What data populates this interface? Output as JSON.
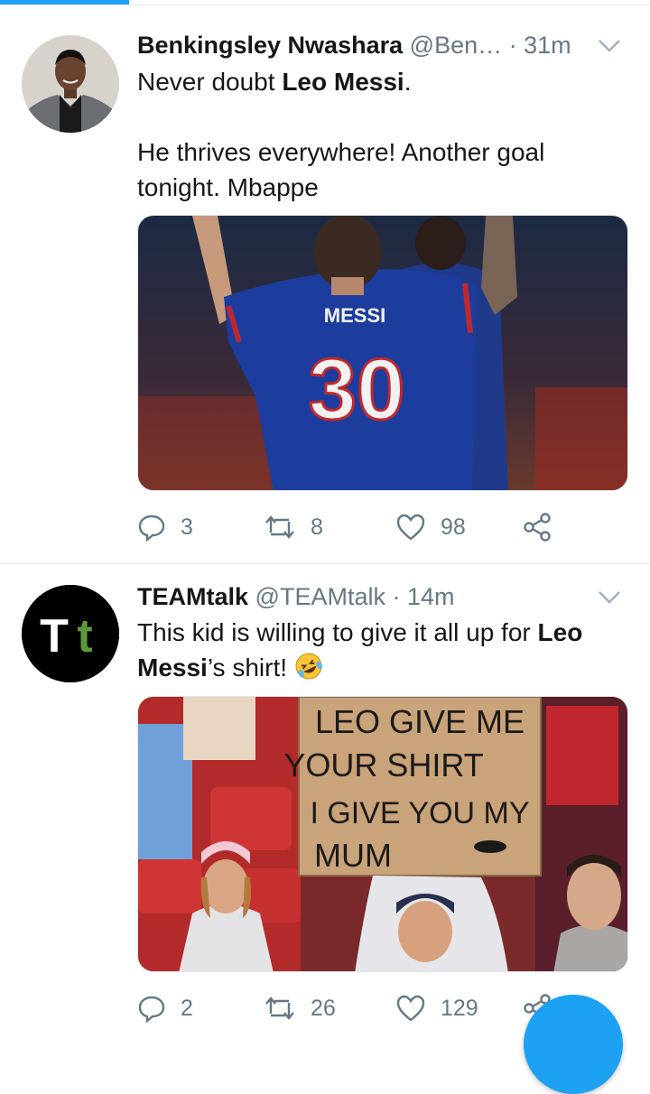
{
  "colors": {
    "accent": "#1da1f2",
    "text": "#14171a",
    "muted": "#657786",
    "divider": "#e1e8ed"
  },
  "tweets": [
    {
      "author_name": "Benkingsley Nwashara",
      "handle": "@Ben…",
      "separator": "·",
      "time": "31m",
      "text_line1_before": "Never doubt ",
      "text_line1_bold": "Leo Messi",
      "text_line1_after": ".",
      "text_line2": "He thrives everywhere! Another goal tonight. Mbappe",
      "media": {
        "name_text": "MESSI",
        "number_text": "30"
      },
      "replies": "3",
      "retweets": "8",
      "likes": "98",
      "icons": [
        "reply-icon",
        "retweet-icon",
        "like-icon",
        "share-icon",
        "chevron-down-icon"
      ]
    },
    {
      "author_name": "TEAMtalk",
      "handle": "@TEAMtalk",
      "separator": "·",
      "time": "14m",
      "avatar_text_1": "T",
      "avatar_text_2": "t",
      "text_before": "This kid is willing to give it all up for ",
      "text_bold1": "Leo Messi",
      "text_after": "’s shirt! ",
      "emoji": "rolling-on-floor-laughing",
      "media": {
        "sign_line1": "LEO GIVE ME",
        "sign_line2": "YOUR SHIRT",
        "sign_line3": "I GIVE YOU MY",
        "sign_line4": "MUM"
      },
      "replies": "2",
      "retweets": "26",
      "likes": "129",
      "icons": [
        "reply-icon",
        "retweet-icon",
        "like-icon",
        "share-icon",
        "chevron-down-icon"
      ]
    }
  ]
}
